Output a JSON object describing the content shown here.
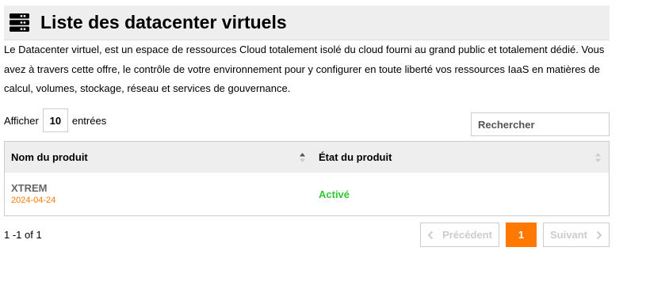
{
  "header": {
    "title": "Liste des datacenter virtuels",
    "icon": "server-icon"
  },
  "description": "Le Datacenter virtuel, est un espace de ressources Cloud totalement isolé du cloud fourni au grand public et totalement dédié. Vous avez à travers cette offre, le contrôle de votre environnement pour y configurer en toute liberté vos ressources IaaS en matières de calcul, volumes, stockage, réseau et services de gouvernance.",
  "length_control": {
    "prefix": "Afficher",
    "value": "10",
    "suffix": "entrées"
  },
  "search": {
    "placeholder": "Rechercher",
    "value": ""
  },
  "table": {
    "columns": [
      {
        "label": "Nom du produit",
        "sort": "ascending"
      },
      {
        "label": "État du produit",
        "sort": "none"
      }
    ],
    "rows": [
      {
        "name": "XTREM",
        "date": "2024-04-24",
        "state": "Activé"
      }
    ]
  },
  "info": "1 -1 of 1",
  "pagination": {
    "previous": "Précédent",
    "current": "1",
    "next": "Suivant"
  },
  "colors": {
    "accent": "#ff7900",
    "active_state": "#32c832",
    "header_bg": "#eeeeee",
    "border": "#cccccc",
    "disabled": "#cccccc"
  }
}
